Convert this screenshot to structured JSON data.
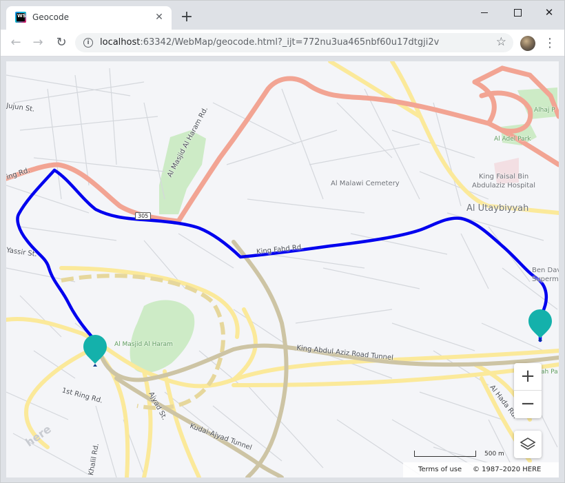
{
  "browser": {
    "tab_title": "Geocode",
    "favicon_text": "WS",
    "new_tab_symbol": "+",
    "url_host": "localhost",
    "url_rest": ":63342/WebMap/geocode.html?_ijt=772nu3ua465nbf60u17dtgji2v"
  },
  "map": {
    "districts": {
      "utaybiyyah": "Al Utaybiyyah"
    },
    "pois": {
      "cemetery": "Al Malawi Cemetery",
      "hospital_line1": "King Faisal Bin",
      "hospital_line2": "Abdulaziz Hospital",
      "ben_dawood_line1": "Ben Dav",
      "ben_dawood_line2": "Supermi"
    },
    "parks": {
      "haram": "Al Masjid Al Haram",
      "adel": "Al Adel Park",
      "alhaj": "Alhaj P",
      "hah": "ah Pa"
    },
    "roads": {
      "masjid_haram_rd": "Al Masjid Al Haram Rd.",
      "king_fahd": "King Fahd Rd.",
      "king_abdul_aziz_tunnel": "King Abdul Aziz Road Tunnel",
      "ring_rd_top": "ing Rd.",
      "first_ring": "1st Ring Rd.",
      "ajyad": "Ajyad St.",
      "kudai_ajyad": "Kudai-Ajyad Tunnel",
      "khalil": "Khalil Rd.",
      "al_hada": "Al Hada Rd.",
      "ujun": "Jujun St.",
      "yassir": "Yassir St.",
      "shield_305": "305"
    },
    "controls": {
      "zoom_in": "+",
      "zoom_out": "−",
      "layers_icon": "layers-icon"
    },
    "scale_label": "500 m",
    "terms": "Terms of use",
    "copyright": "© 1987–2020 HERE",
    "logo": "here",
    "colors": {
      "route": "#0000ee",
      "marker": "#14b1ab",
      "major_road": "#f2a493",
      "arterial": "#fbe99a",
      "tunnel": "#cdc4a4",
      "park": "#cdebc6",
      "background": "#f4f5f8"
    }
  }
}
